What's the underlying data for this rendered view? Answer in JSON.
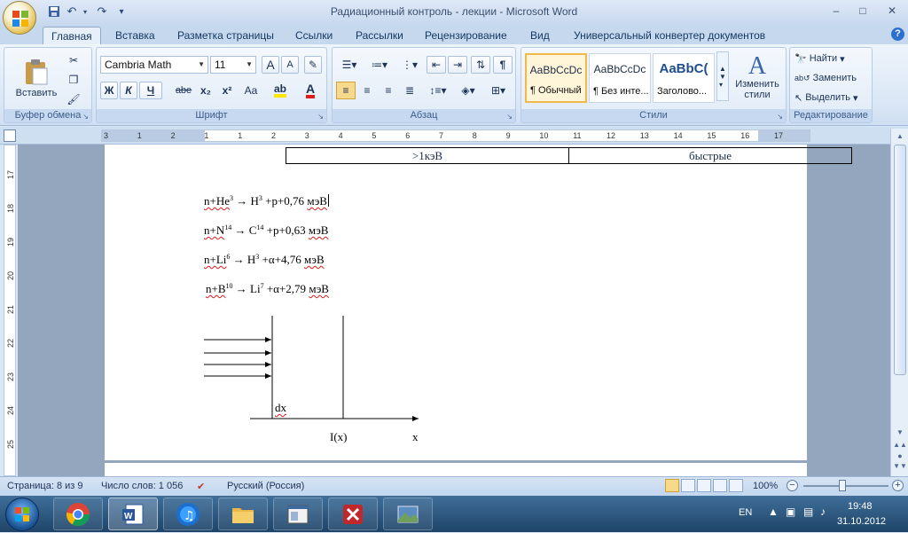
{
  "window": {
    "title": "Радиационный контроль - лекции - Microsoft Word",
    "minimize": "–",
    "maximize": "□",
    "close": "✕"
  },
  "tabs": [
    {
      "label": "Главная",
      "active": true
    },
    {
      "label": "Вставка"
    },
    {
      "label": "Разметка страницы"
    },
    {
      "label": "Ссылки"
    },
    {
      "label": "Рассылки"
    },
    {
      "label": "Рецензирование"
    },
    {
      "label": "Вид"
    },
    {
      "label": "Универсальный конвертер документов"
    }
  ],
  "ribbon": {
    "clipboard": {
      "paste": "Вставить",
      "label": "Буфер обмена"
    },
    "font": {
      "name": "Cambria Math",
      "size": "11",
      "label": "Шрифт",
      "bold": "Ж",
      "italic": "К",
      "underline": "Ч",
      "strike": "abe",
      "subscript": "x₂",
      "superscript": "x²",
      "case": "Aa",
      "grow": "A",
      "shrink": "A"
    },
    "paragraph": {
      "label": "Абзац",
      "pilcrow": "¶"
    },
    "styles": {
      "label": "Стили",
      "change_styles": "Изменить стили",
      "items": [
        {
          "sample": "AaBbCcDc",
          "name": "¶ Обычный"
        },
        {
          "sample": "AaBbCcDc",
          "name": "¶ Без инте..."
        },
        {
          "sample": "AaBbC(",
          "name": "Заголово..."
        }
      ]
    },
    "editing": {
      "label": "Редактирование",
      "find": "Найти",
      "replace": "Заменить",
      "select": "Выделить"
    }
  },
  "ruler": {
    "numbers": [
      "3",
      "1",
      "2",
      "1",
      "1",
      "2",
      "3",
      "4",
      "5",
      "6",
      "7",
      "8",
      "9",
      "10",
      "11",
      "12",
      "13",
      "14",
      "15",
      "16",
      "17"
    ],
    "vnumbers": [
      "17",
      "18",
      "19",
      "20",
      "21",
      "22",
      "23",
      "24",
      "25"
    ]
  },
  "document": {
    "table_row": [
      ">1кэВ",
      "быстрые"
    ],
    "equations": [
      {
        "pre": "n+He",
        "sup1": "3",
        "mid": " → H",
        "sup2": "3",
        "post": " +p+0,76 ",
        "unit": "мэВ"
      },
      {
        "pre": "n+N",
        "sup1": "14",
        "mid": " → C",
        "sup2": "14",
        "post": " +p+0,63 ",
        "unit": "мэВ"
      },
      {
        "pre": "n+Li",
        "sup1": "6",
        "mid": " → H",
        "sup2": "3",
        "post": " +α+4,76 ",
        "unit": "мэВ"
      },
      {
        "pre": "n+B",
        "sup1": "10",
        "mid": " → Li",
        "sup2": "7",
        "post": " +α+2,79 ",
        "unit": "мэВ"
      }
    ],
    "diagram": {
      "dx_label": "dx",
      "i_label": "I(x)",
      "x_label": "x"
    }
  },
  "status": {
    "page": "Страница: 8 из 9",
    "words": "Число слов: 1 056",
    "language": "Русский (Россия)",
    "zoom": "100%"
  },
  "taskbar": {
    "lang": "EN",
    "time": "19:48",
    "date": "31.10.2012"
  }
}
